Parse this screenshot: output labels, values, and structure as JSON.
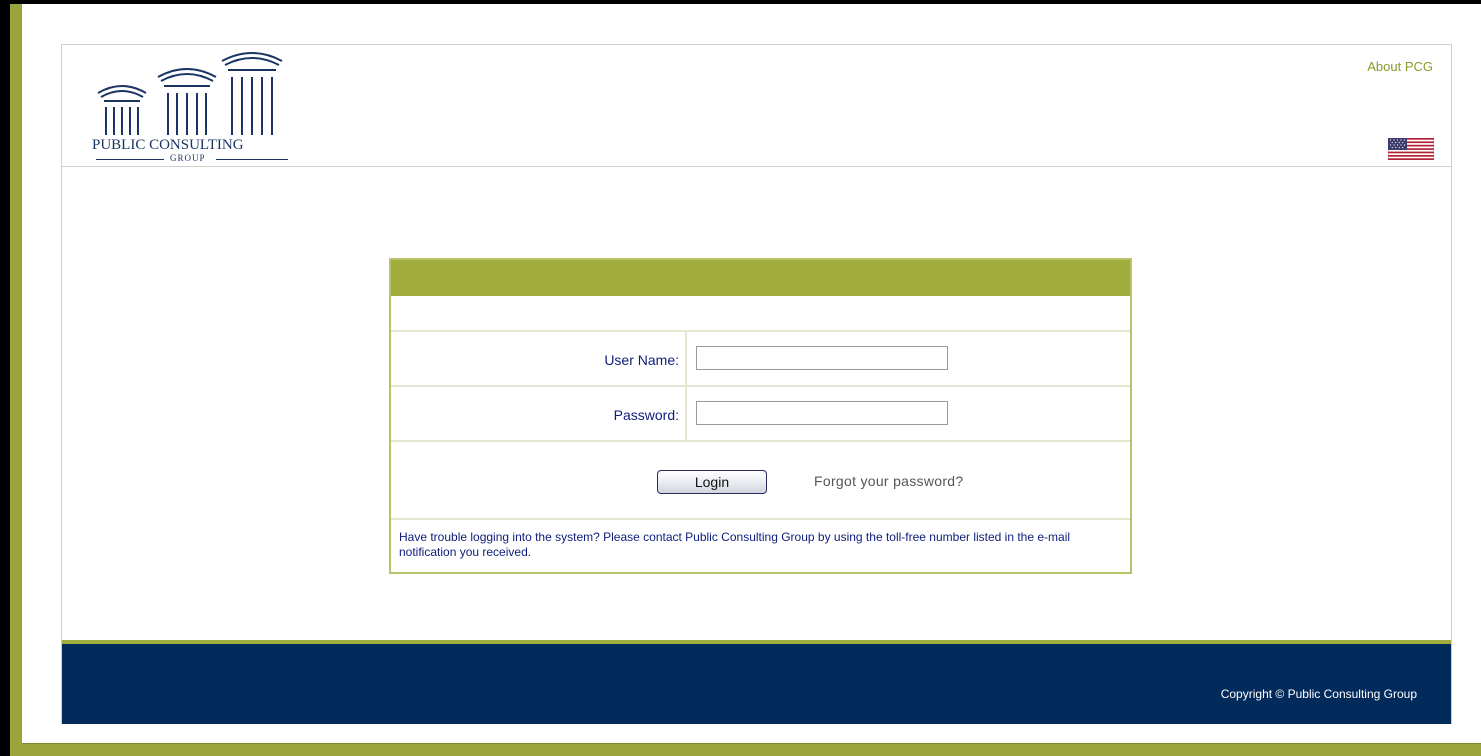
{
  "header": {
    "logo": {
      "name_line": "PUBLIC CONSULTING",
      "sub_line": "GROUP"
    },
    "about_link": "About PCG",
    "flag_icon": "us-flag-icon"
  },
  "login": {
    "username_label": "User Name:",
    "username_value": "",
    "password_label": "Password:",
    "password_value": "",
    "login_button": "Login",
    "forgot_link": "Forgot your password?",
    "help_text": "Have trouble logging into the system? Please contact Public Consulting Group by using the toll-free number listed in the e-mail notification you received."
  },
  "footer": {
    "copyright": "Copyright © Public Consulting Group"
  },
  "colors": {
    "accent_olive": "#a0ac3c",
    "footer_navy": "#022b5c",
    "label_blue": "#0d1d7a"
  }
}
